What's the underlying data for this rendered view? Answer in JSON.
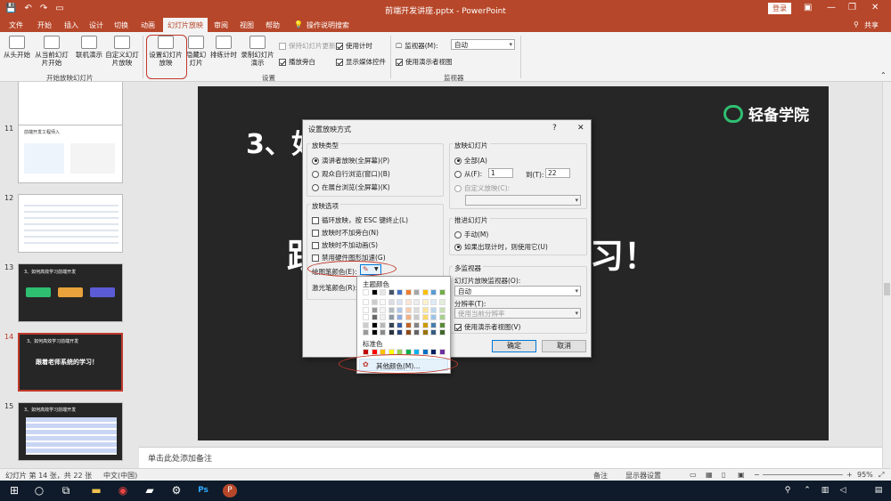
{
  "window": {
    "title": "前端开发讲座.pptx  -  PowerPoint",
    "login": "登录",
    "share": "共享"
  },
  "tabs": [
    "文件",
    "开始",
    "插入",
    "设计",
    "切换",
    "动画",
    "幻灯片放映",
    "审阅",
    "视图",
    "帮助",
    "操作说明搜索"
  ],
  "ribbon": {
    "from_start": "从头开始",
    "from_current": "从当前幻灯片开始",
    "online": "联机演示",
    "custom": "自定义幻灯片放映",
    "group_start": "开始放映幻灯片",
    "setup": "设置幻灯片放映",
    "hide": "隐藏幻灯片",
    "rehearse": "排练计时",
    "record": "录制幻灯片演示",
    "keep_updated": "保持幻灯片更新",
    "use_timing": "使用计时",
    "play_narration": "播放旁白",
    "show_media": "显示媒体控件",
    "group_setup": "设置",
    "monitor_label": "监视器(M):",
    "monitor_value": "自动",
    "presenter_view": "使用演示者视图",
    "group_monitor": "监视器"
  },
  "thumbnails": [
    {
      "num": "11",
      "text": "前端开发工程师入"
    },
    {
      "num": "12",
      "text": ""
    },
    {
      "num": "13",
      "text": "3、如何高效学习前端开发"
    },
    {
      "num": "14",
      "text": "跟着老师系统的学习！"
    },
    {
      "num": "15",
      "text": "3、如何高效学习前端开发"
    }
  ],
  "slide": {
    "title": "3、如",
    "big": "跟",
    "big_right": "习！",
    "logo": "轻备学院"
  },
  "notes": "单击此处添加备注",
  "status": {
    "slide_info": "幻灯片 第 14 张，共 22 张",
    "lang": "中文(中国)",
    "notes_btn": "备注",
    "display_btn": "显示器设置",
    "zoom": "95%"
  },
  "dialog": {
    "title": "设置放映方式",
    "help": "?",
    "show_type": "放映类型",
    "type_presenter": "演讲者放映(全屏幕)(P)",
    "type_window": "观众自行浏览(窗口)(B)",
    "type_kiosk": "在展台浏览(全屏幕)(K)",
    "options": "放映选项",
    "opt_loop": "循环放映，按 ESC 键终止(L)",
    "opt_no_narr": "放映时不加旁白(N)",
    "opt_no_anim": "放映时不加动画(S)",
    "opt_no_hw": "禁用硬件图形加速(G)",
    "pen_color": "绘图笔颜色(E):",
    "laser_color": "激光笔颜色(R):",
    "show_slides": "放映幻灯片",
    "all": "全部(A)",
    "from": "从(F):",
    "from_val": "1",
    "to": "到(T):",
    "to_val": "22",
    "custom_show": "自定义放映(C):",
    "advance": "推进幻灯片",
    "manual": "手动(M)",
    "use_timings": "如果出现计时，则使用它(U)",
    "multi": "多监视器",
    "monitor": "幻灯片放映监视器(O):",
    "monitor_val": "自动",
    "resolution": "分辨率(T):",
    "resolution_val": "使用当前分辨率",
    "presenter": "使用演示者视图(V)",
    "ok": "确定",
    "cancel": "取消"
  },
  "picker": {
    "theme": "主题颜色",
    "standard": "标准色",
    "more": "其他颜色(M)..."
  },
  "colors": {
    "accent": "#b7472a",
    "highlight": "#c0392b",
    "green": "#2fbf71"
  }
}
